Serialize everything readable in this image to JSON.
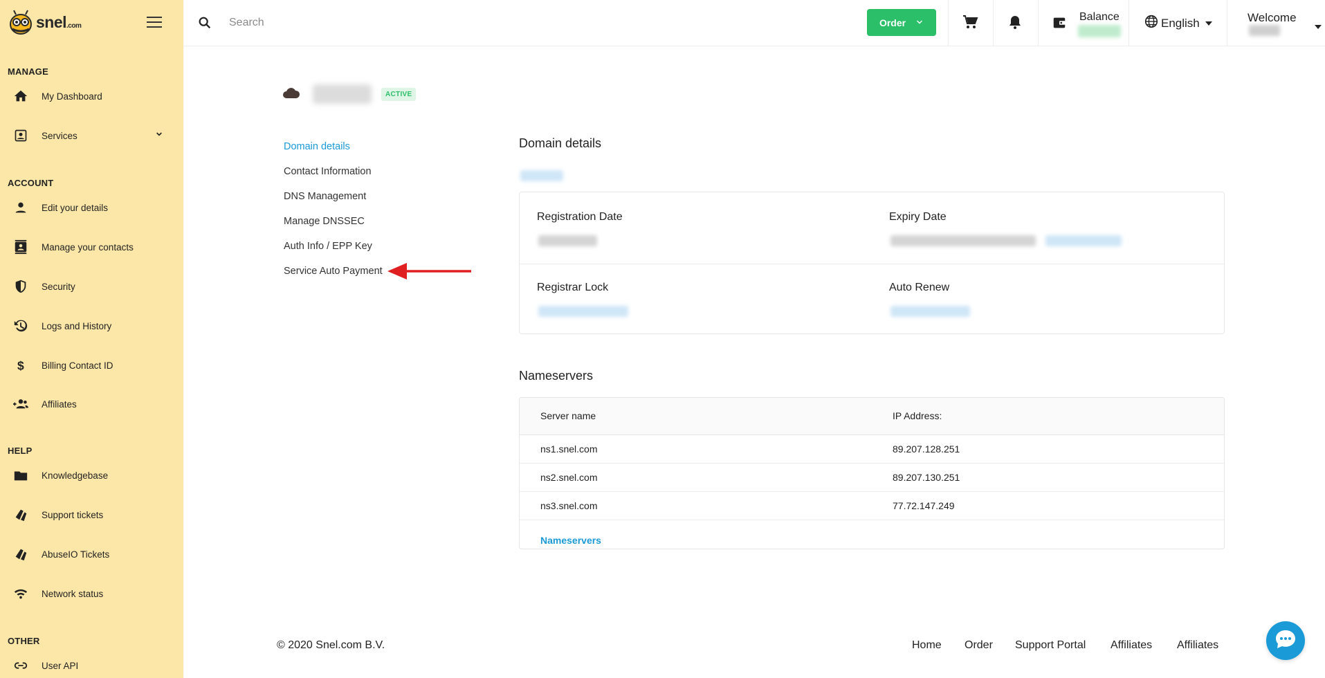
{
  "brand": {
    "name": "snel",
    "suffix": ".com"
  },
  "sidebar": {
    "sections": {
      "manage": "MANAGE",
      "account": "ACCOUNT",
      "help": "HELP",
      "other": "OTHER"
    },
    "items": [
      {
        "label": "My Dashboard",
        "icon": "home-icon"
      },
      {
        "label": "Services",
        "icon": "services-icon"
      },
      {
        "label": "Edit your details",
        "icon": "person-icon"
      },
      {
        "label": "Manage your contacts",
        "icon": "contacts-icon"
      },
      {
        "label": "Security",
        "icon": "shield-icon"
      },
      {
        "label": "Logs and History",
        "icon": "history-icon"
      },
      {
        "label": "Billing Contact ID",
        "icon": "dollar-icon"
      },
      {
        "label": "Affiliates",
        "icon": "group-add-icon"
      },
      {
        "label": "Knowledgebase",
        "icon": "folder-icon"
      },
      {
        "label": "Support tickets",
        "icon": "tickets-icon"
      },
      {
        "label": "AbuseIO Tickets",
        "icon": "tickets-icon"
      },
      {
        "label": "Network status",
        "icon": "wifi-icon"
      },
      {
        "label": "User API",
        "icon": "link-icon"
      }
    ]
  },
  "topbar": {
    "search_placeholder": "Search",
    "order_label": "Order",
    "balance_label": "Balance",
    "language": "English",
    "welcome": "Welcome"
  },
  "service": {
    "status": "ACTIVE"
  },
  "subnav": [
    "Domain details",
    "Contact Information",
    "DNS Management",
    "Manage DNSSEC",
    "Auth Info / EPP Key",
    "Service Auto Payment"
  ],
  "domain_details": {
    "title": "Domain details",
    "registration_date_label": "Registration Date",
    "expiry_date_label": "Expiry Date",
    "registrar_lock_label": "Registrar Lock",
    "auto_renew_label": "Auto Renew"
  },
  "nameservers": {
    "title": "Nameservers",
    "col_server": "Server name",
    "col_ip": "IP Address:",
    "rows": [
      {
        "server": "ns1.snel.com",
        "ip": "89.207.128.251"
      },
      {
        "server": "ns2.snel.com",
        "ip": "89.207.130.251"
      },
      {
        "server": "ns3.snel.com",
        "ip": "77.72.147.249"
      }
    ],
    "link": "Nameservers"
  },
  "footer": {
    "copyright": "© 2020 Snel.com B.V.",
    "links": [
      "Home",
      "Order",
      "Support Portal",
      "Affiliates",
      "Affiliates"
    ]
  },
  "colors": {
    "accent": "#2bbf6a",
    "link": "#1a9ad6",
    "sidebar_bg": "#fde7a8",
    "annotation_arrow": "#e02020"
  }
}
